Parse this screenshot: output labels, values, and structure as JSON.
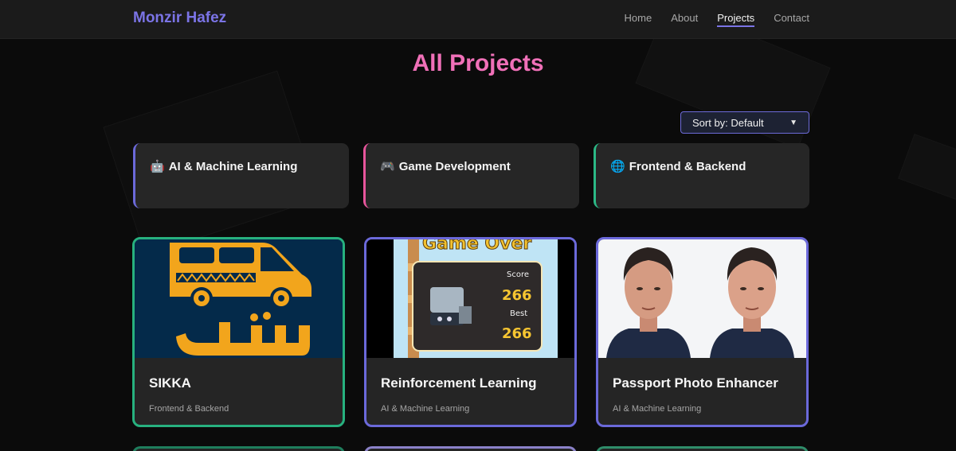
{
  "nav": {
    "brand": "Monzir Hafez",
    "links": [
      {
        "label": "Home",
        "active": false
      },
      {
        "label": "About",
        "active": false
      },
      {
        "label": "Projects",
        "active": true
      },
      {
        "label": "Contact",
        "active": false
      }
    ]
  },
  "page": {
    "title": "All Projects",
    "sort_label": "Sort by: Default"
  },
  "categories": [
    {
      "emoji": "🤖",
      "label": "AI & Machine Learning",
      "accent": "#6b69da"
    },
    {
      "emoji": "🎮",
      "label": "Game Development",
      "accent": "#e8559c"
    },
    {
      "emoji": "🌐",
      "label": "Frontend & Backend",
      "accent": "#2bb986"
    }
  ],
  "projects": [
    {
      "title": "SIKKA",
      "category": "Frontend & Backend",
      "border": "#27b17f"
    },
    {
      "title": "Reinforcement Learning",
      "category": "AI & Machine Learning",
      "border": "#6b69da"
    },
    {
      "title": "Passport Photo Enhancer",
      "category": "AI & Machine Learning",
      "border": "#6b69da"
    }
  ],
  "thumbs": {
    "game_over_heading": "Game Over",
    "score_label": "Score",
    "score_value": "266",
    "best_label": "Best",
    "best_value": "266"
  },
  "colors": {
    "brand": "#7b74e6",
    "title_pink": "#f070b8",
    "background": "#0b0b0b"
  }
}
